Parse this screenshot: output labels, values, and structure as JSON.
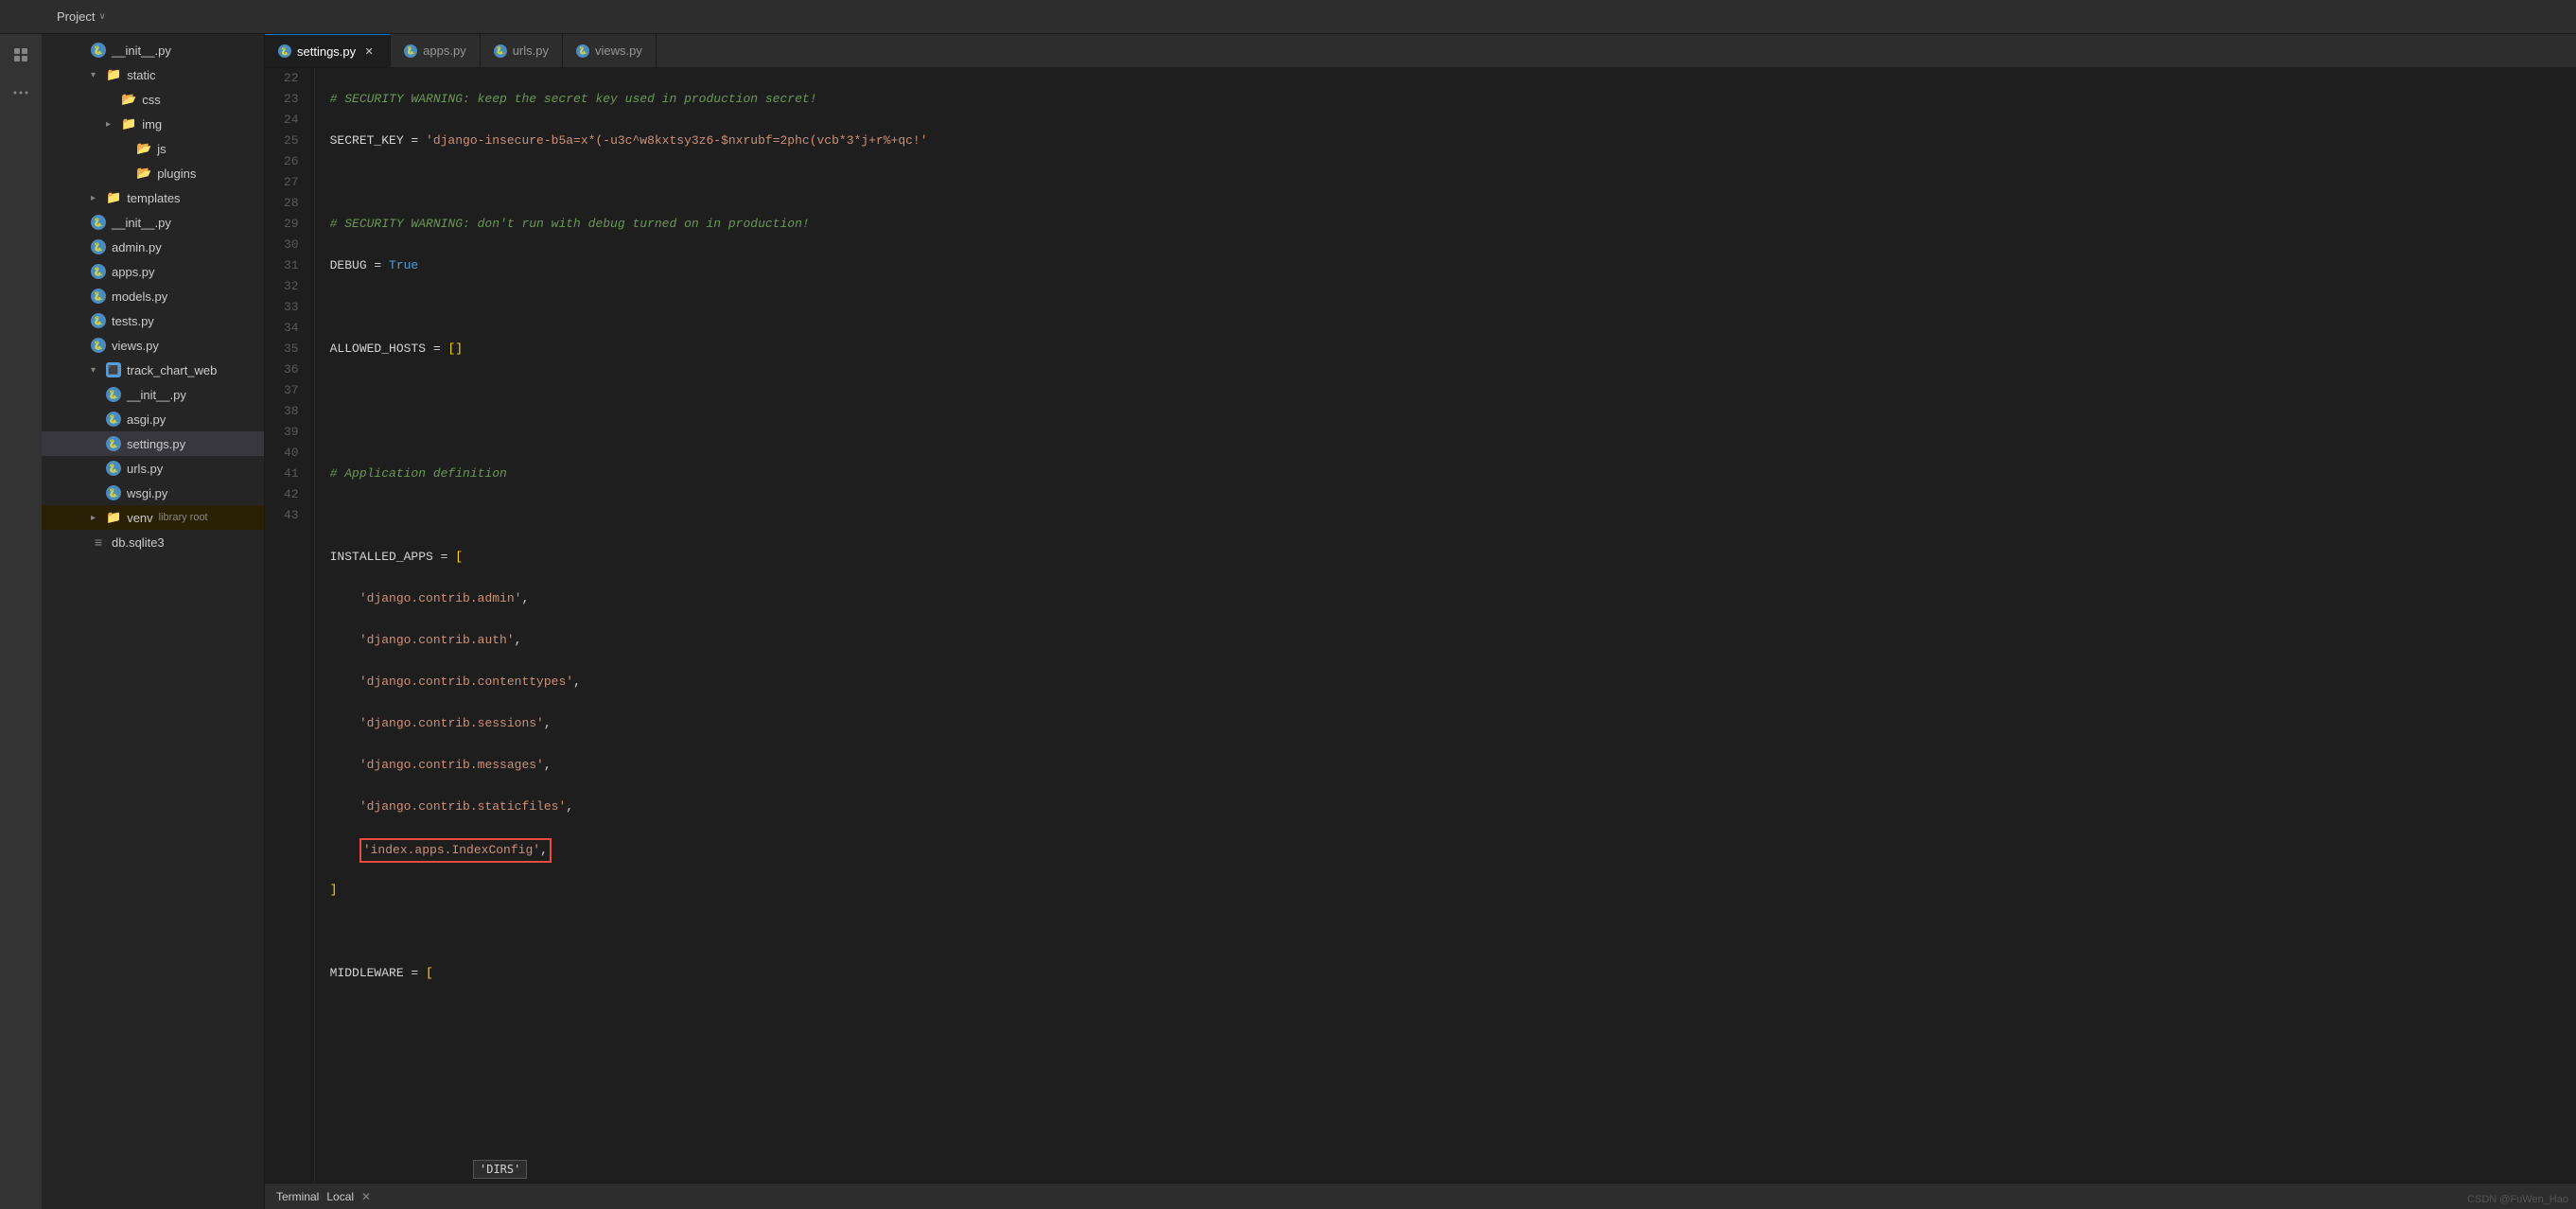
{
  "topbar": {
    "title": "Project",
    "chevron": "∨"
  },
  "tabs": [
    {
      "id": "settings",
      "label": "settings.py",
      "active": true,
      "closeable": true
    },
    {
      "id": "apps",
      "label": "apps.py",
      "active": false,
      "closeable": false
    },
    {
      "id": "urls",
      "label": "urls.py",
      "active": false,
      "closeable": false
    },
    {
      "id": "views",
      "label": "views.py",
      "active": false,
      "closeable": false
    }
  ],
  "filetree": {
    "items": [
      {
        "id": "init1",
        "type": "py",
        "label": "__init__.py",
        "indent": 0
      },
      {
        "id": "static",
        "type": "folder",
        "label": "static",
        "indent": 0,
        "expanded": true
      },
      {
        "id": "css",
        "type": "folder-leaf",
        "label": "css",
        "indent": 1
      },
      {
        "id": "img",
        "type": "folder",
        "label": "img",
        "indent": 1,
        "expanded": false
      },
      {
        "id": "js",
        "type": "folder-leaf",
        "label": "js",
        "indent": 2
      },
      {
        "id": "plugins",
        "type": "folder-leaf",
        "label": "plugins",
        "indent": 2
      },
      {
        "id": "templates",
        "type": "folder",
        "label": "templates",
        "indent": 0,
        "expanded": false
      },
      {
        "id": "init2",
        "type": "py",
        "label": "__init__.py",
        "indent": 0
      },
      {
        "id": "admin",
        "type": "py",
        "label": "admin.py",
        "indent": 0
      },
      {
        "id": "apps",
        "type": "py",
        "label": "apps.py",
        "indent": 0
      },
      {
        "id": "models",
        "type": "py",
        "label": "models.py",
        "indent": 0
      },
      {
        "id": "tests",
        "type": "py",
        "label": "tests.py",
        "indent": 0
      },
      {
        "id": "views",
        "type": "py",
        "label": "views.py",
        "indent": 0
      },
      {
        "id": "track_chart_web",
        "type": "folder",
        "label": "track_chart_web",
        "indent": 0,
        "expanded": true
      },
      {
        "id": "init3",
        "type": "py",
        "label": "__init__.py",
        "indent": 1
      },
      {
        "id": "asgi",
        "type": "py",
        "label": "asgi.py",
        "indent": 1
      },
      {
        "id": "settings",
        "type": "py",
        "label": "settings.py",
        "indent": 1,
        "selected": true
      },
      {
        "id": "urls2",
        "type": "py",
        "label": "urls.py",
        "indent": 1
      },
      {
        "id": "wsgi",
        "type": "py",
        "label": "wsgi.py",
        "indent": 1
      },
      {
        "id": "venv",
        "type": "folder",
        "label": "venv",
        "indent": 0,
        "expanded": false,
        "sublabel": "library root"
      },
      {
        "id": "db",
        "type": "db",
        "label": "db.sqlite3",
        "indent": 0
      }
    ]
  },
  "code": {
    "lines": [
      {
        "num": 22,
        "content": "comment",
        "text": "# SECURITY WARNING: keep the secret key used in production secret!"
      },
      {
        "num": 23,
        "content": "secret_key",
        "text": "SECRET_KEY = 'django-insecure-b5a=x*(-u3c^w8kxtsy3z6-$nxrubf=2phc(vcb*3*j+r%+qc!'"
      },
      {
        "num": 24,
        "content": "blank",
        "text": ""
      },
      {
        "num": 25,
        "content": "comment",
        "text": "# SECURITY WARNING: don't run with debug turned on in production!"
      },
      {
        "num": 26,
        "content": "debug",
        "text": "DEBUG = True"
      },
      {
        "num": 27,
        "content": "blank",
        "text": ""
      },
      {
        "num": 28,
        "content": "allowed_hosts",
        "text": "ALLOWED_HOSTS = []"
      },
      {
        "num": 29,
        "content": "blank",
        "text": ""
      },
      {
        "num": 30,
        "content": "blank",
        "text": ""
      },
      {
        "num": 31,
        "content": "comment",
        "text": "# Application definition"
      },
      {
        "num": 32,
        "content": "blank",
        "text": ""
      },
      {
        "num": 33,
        "content": "installed_apps_start",
        "text": "INSTALLED_APPS = ["
      },
      {
        "num": 34,
        "content": "app1",
        "text": "    'django.contrib.admin',"
      },
      {
        "num": 35,
        "content": "app2",
        "text": "    'django.contrib.auth',"
      },
      {
        "num": 36,
        "content": "app3",
        "text": "    'django.contrib.contenttypes',"
      },
      {
        "num": 37,
        "content": "app4",
        "text": "    'django.contrib.sessions',"
      },
      {
        "num": 38,
        "content": "app5",
        "text": "    'django.contrib.messages',"
      },
      {
        "num": 39,
        "content": "app6",
        "text": "    'django.contrib.staticfiles',"
      },
      {
        "num": 40,
        "content": "app7_highlight",
        "text": "    'index.apps.IndexConfig',"
      },
      {
        "num": 41,
        "content": "installed_apps_end",
        "text": "]"
      },
      {
        "num": 42,
        "content": "blank",
        "text": ""
      },
      {
        "num": 43,
        "content": "middleware_start",
        "text": "MIDDLEWARE = ["
      }
    ]
  },
  "bottom": {
    "terminal_label": "Terminal",
    "local_label": "Local",
    "close_icon": "✕"
  },
  "watermark": "CSDN @FuWen_Hao"
}
